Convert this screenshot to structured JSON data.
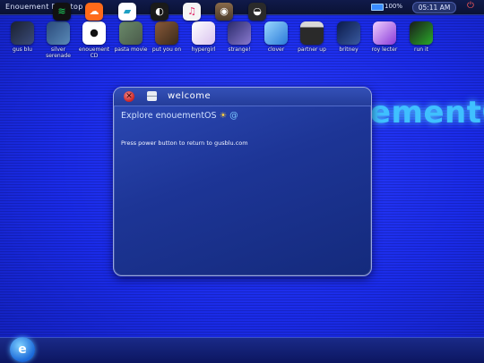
{
  "topbar": {
    "title": "Enouement Desktop",
    "battery_text": "100%",
    "clock": "05:11 AM"
  },
  "background": {
    "text": "ementC"
  },
  "apps": [
    {
      "label": "gus blu",
      "color": "#2b3c6a"
    },
    {
      "label": "silver serenade",
      "color": "#3a5b8c"
    },
    {
      "label": "enouement CD",
      "color": "#e8e8e8"
    },
    {
      "label": "pasta movie",
      "color": "#5a7a6a"
    },
    {
      "label": "put you on",
      "color": "#6a4a3a"
    },
    {
      "label": "hypergirl",
      "color": "#e8d8f0"
    },
    {
      "label": "strange!",
      "color": "#5a4fa0"
    },
    {
      "label": "clover",
      "color": "#4aa0e8"
    },
    {
      "label": "partner up",
      "color": "#4a4a4a"
    },
    {
      "label": "britney",
      "color": "#1a2a6a"
    },
    {
      "label": "roy lecter",
      "color": "#b070e0"
    },
    {
      "label": "run it",
      "color": "#2a8a2a"
    }
  ],
  "window": {
    "title": "welcome",
    "heading": "Explore enouementOS",
    "heading_icons": [
      "sun-icon",
      "swirl-icon"
    ],
    "body": "Press power button to return to gusblu.com"
  },
  "dock": {
    "home_icon": "e",
    "items": [
      {
        "name": "spotify-icon",
        "glyph": "≋",
        "color": "#1ed760"
      },
      {
        "name": "soundcloud-icon",
        "glyph": "☁",
        "color": "#ff6a1a"
      },
      {
        "name": "bandcamp-icon",
        "glyph": "▰",
        "color": "#1da0c3"
      },
      {
        "name": "dark-app-icon",
        "glyph": "◐",
        "color": "#1a1a1a"
      },
      {
        "name": "music-icon",
        "glyph": "♫",
        "color": "#f0f0f0"
      },
      {
        "name": "instagram-icon",
        "glyph": "◉",
        "color": "#8a6a4a"
      },
      {
        "name": "photo-app-icon",
        "glyph": "◒",
        "color": "#2a2a2a"
      }
    ]
  }
}
